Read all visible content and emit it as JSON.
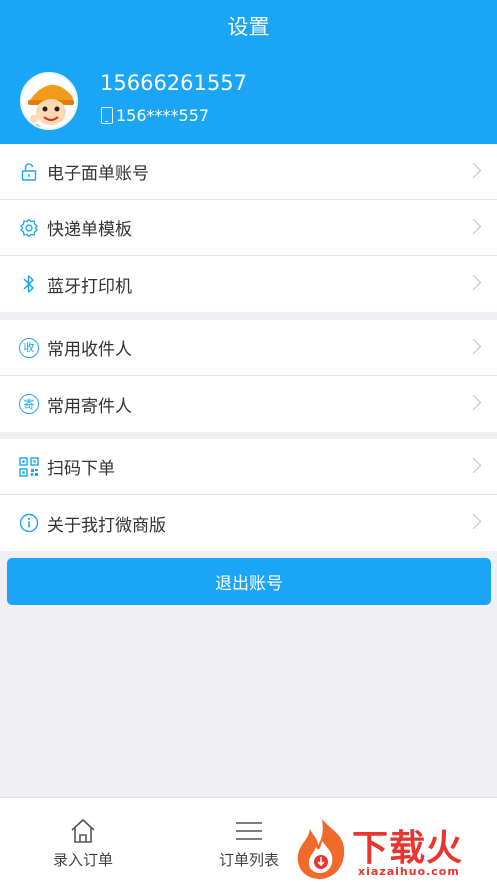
{
  "header": {
    "title": "设置",
    "user_name": "15666261557",
    "user_phone": "156****557"
  },
  "groups": [
    {
      "items": [
        {
          "label": "电子面单账号",
          "icon": "unlock-icon"
        },
        {
          "label": "快递单模板",
          "icon": "gear-icon"
        },
        {
          "label": "蓝牙打印机",
          "icon": "bluetooth-icon"
        }
      ]
    },
    {
      "items": [
        {
          "label": "常用收件人",
          "icon": "receive-icon",
          "glyph": "收"
        },
        {
          "label": "常用寄件人",
          "icon": "send-icon",
          "glyph": "寄"
        }
      ]
    },
    {
      "items": [
        {
          "label": "扫码下单",
          "icon": "qr-code-icon"
        },
        {
          "label": "关于我打微商版",
          "icon": "info-icon"
        }
      ]
    }
  ],
  "logout_label": "退出账号",
  "tabbar": {
    "tabs": [
      {
        "label": "录入订单",
        "icon": "home-icon"
      },
      {
        "label": "订单列表",
        "icon": "list-icon"
      }
    ]
  },
  "watermark": {
    "text": "下载火",
    "domain": "xiazaihuo.com"
  },
  "colors": {
    "accent": "#1ba5f7",
    "background": "#efeff4",
    "watermark": "#e8352f"
  }
}
